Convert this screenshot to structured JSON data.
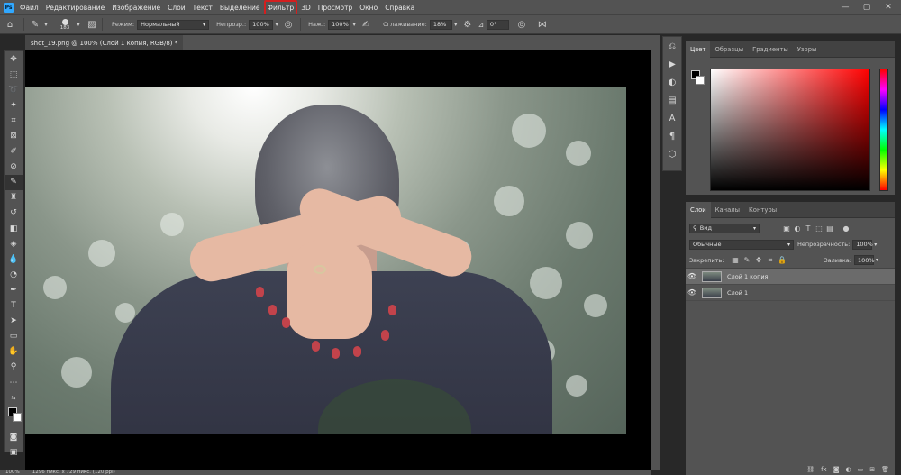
{
  "menubar": {
    "logo": "Ps",
    "items": [
      "Файл",
      "Редактирование",
      "Изображение",
      "Слои",
      "Текст",
      "Выделение",
      "Фильтр",
      "3D",
      "Просмотр",
      "Окно",
      "Справка"
    ],
    "highlighted": "Фильтр",
    "highlight_color": "#d31f1f",
    "window_controls": [
      "—",
      "▢",
      "✕"
    ]
  },
  "options": {
    "brush_size": "183",
    "mode_label": "Режим:",
    "mode_value": "Нормальный",
    "opacity_label": "Непрозр.:",
    "opacity_value": "100%",
    "flow_label": "Наж.:",
    "flow_value": "100%",
    "smoothing_label": "Сглаживание:",
    "smoothing_value": "18%",
    "angle_value": "0°"
  },
  "document": {
    "tab_title": "shot_19.png @ 100% (Слой 1 копия, RGB/8) *"
  },
  "toolbar": {
    "tools": [
      "move-tool-icon",
      "marquee-tool-icon",
      "lasso-tool-icon",
      "magic-wand-icon",
      "crop-tool-icon",
      "frame-tool-icon",
      "eyedropper-icon",
      "healing-brush-icon",
      "brush-tool-icon",
      "clone-stamp-icon",
      "history-brush-icon",
      "eraser-icon",
      "paint-bucket-icon",
      "blur-tool-icon",
      "dodge-tool-icon",
      "pen-tool-icon",
      "type-tool-icon",
      "path-selection-icon",
      "rectangle-tool-icon",
      "hand-tool-icon",
      "zoom-tool-icon",
      "more-tools-icon",
      "swap-colors-icon",
      "color-swatches-icon",
      "quick-mask-icon",
      "screen-mode-icon"
    ]
  },
  "color_panel": {
    "tabs": [
      "Цвет",
      "Образцы",
      "Градиенты",
      "Узоры"
    ],
    "active_tab": "Цвет"
  },
  "layers_panel": {
    "tabs": [
      "Слои",
      "Каналы",
      "Контуры"
    ],
    "active_tab": "Слои",
    "filter_label": "Вид",
    "blend_mode": "Обычные",
    "opacity_label": "Непрозрачность:",
    "opacity_value": "100%",
    "lock_label": "Закрепить:",
    "fill_label": "Заливка:",
    "fill_value": "100%",
    "layers": [
      {
        "name": "Слой 1 копия",
        "selected": true
      },
      {
        "name": "Слой 1",
        "selected": false
      }
    ]
  },
  "status": {
    "zoom": "100%",
    "doc_info": "1296 пикс. x 729 пикс. (120 ppi)"
  }
}
